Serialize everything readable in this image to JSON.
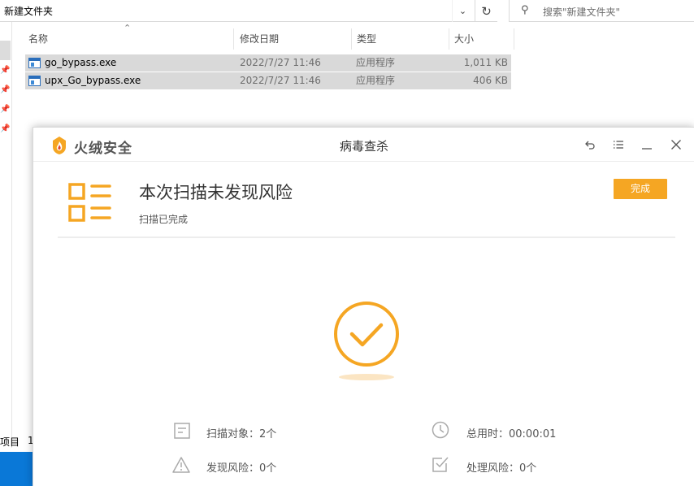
{
  "explorer": {
    "address_path": "新建文件夹",
    "search_placeholder": "搜索\"新建文件夹\"",
    "columns": {
      "name": "名称",
      "date": "修改日期",
      "type": "类型",
      "size": "大小"
    },
    "files": [
      {
        "name": "go_bypass.exe",
        "date": "2022/7/27 11:46",
        "type": "应用程序",
        "size": "1,011 KB"
      },
      {
        "name": "upx_Go_bypass.exe",
        "date": "2022/7/27 11:46",
        "type": "应用程序",
        "size": "406 KB"
      }
    ],
    "status_items": "个项目",
    "status_selected": "1"
  },
  "dialog": {
    "brand": "火绒安全",
    "title": "病毒查杀",
    "summary_title": "本次扫描未发现风险",
    "summary_sub": "扫描已完成",
    "done_label": "完成",
    "stats": {
      "scan_objects": "扫描对象：2个",
      "total_time": "总用时：00:00:01",
      "found_risks": "发现风险：0个",
      "handled_risks": "处理风险：0个"
    },
    "accent_color": "#f5a623"
  }
}
